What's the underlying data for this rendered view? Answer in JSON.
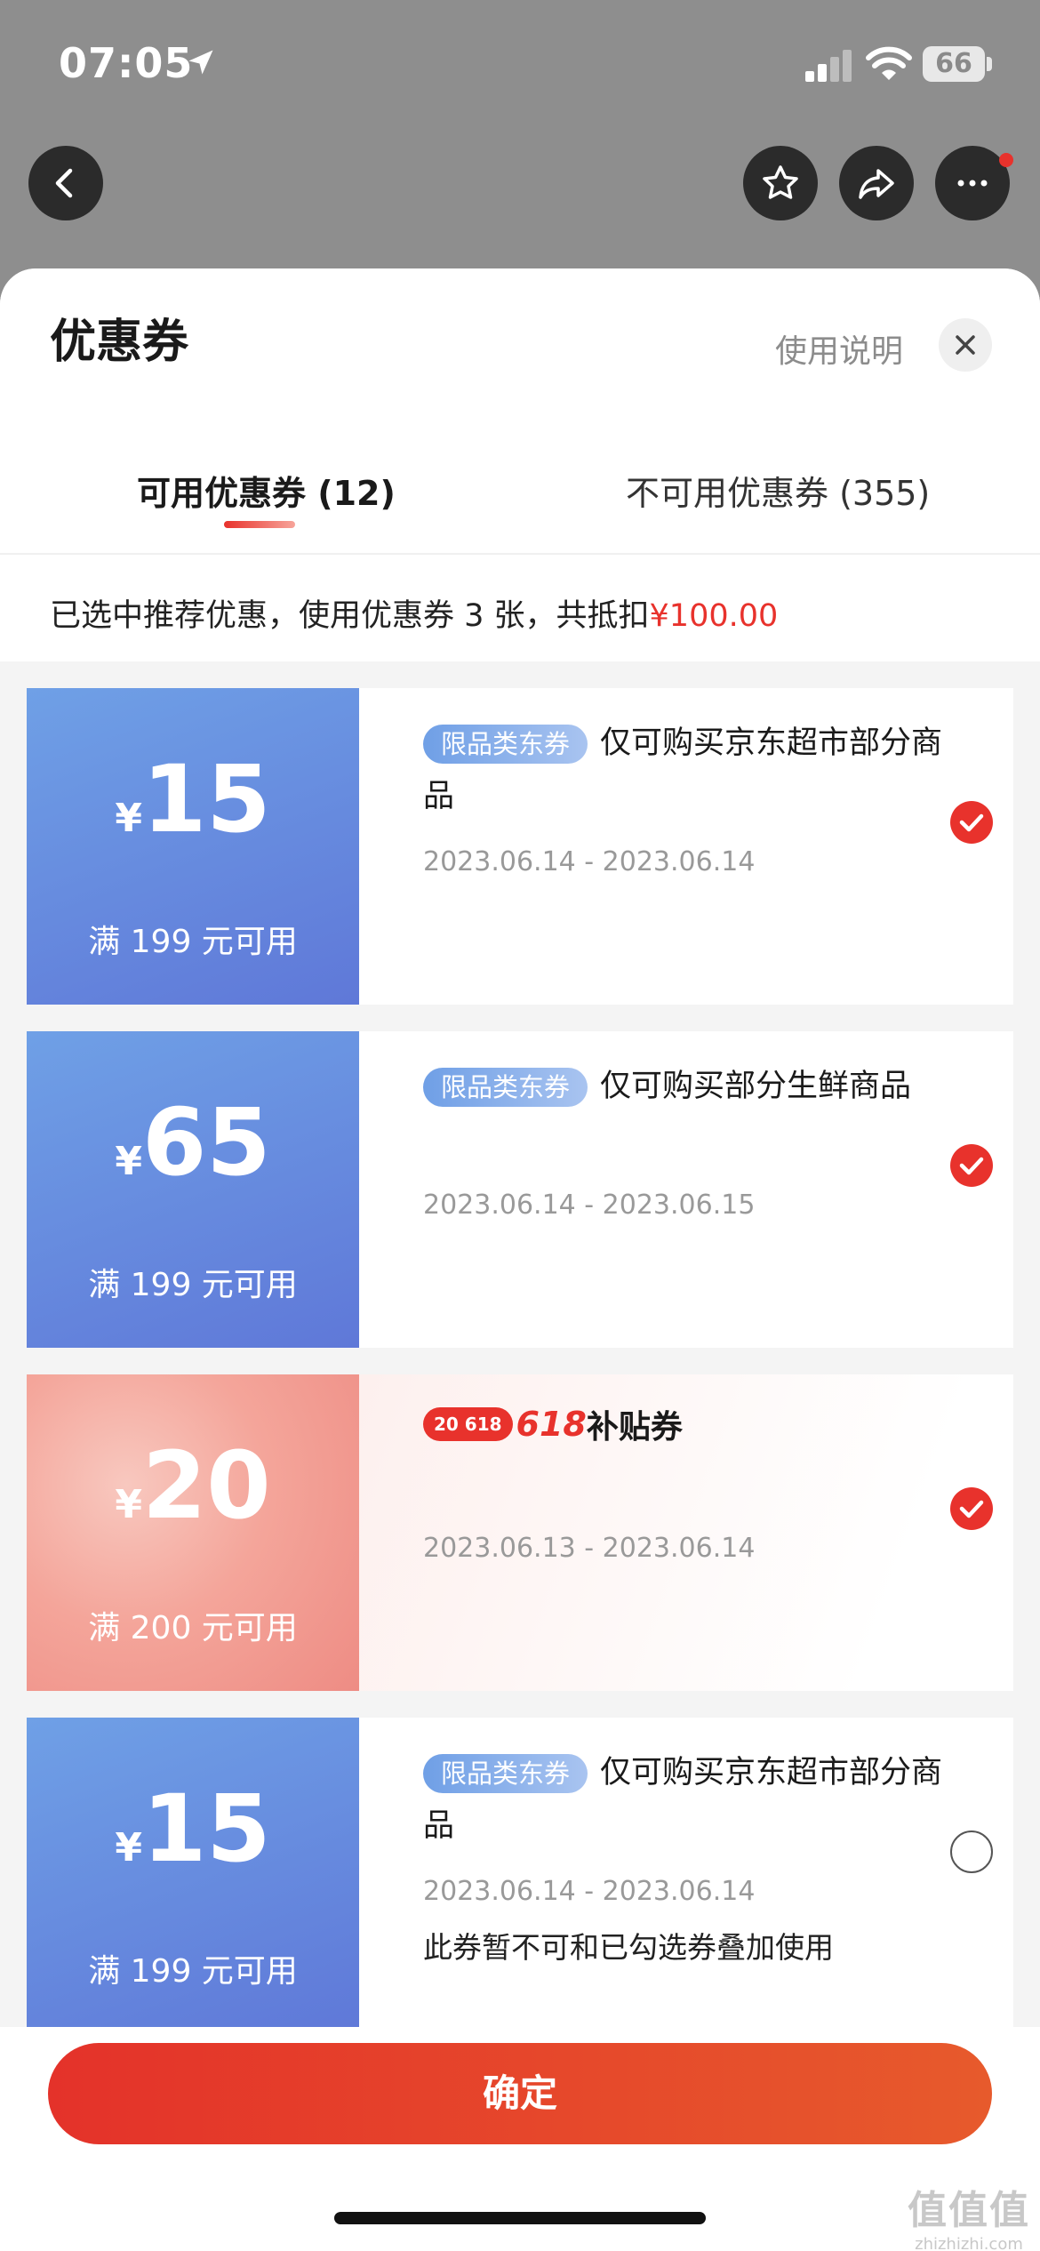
{
  "status_bar": {
    "time": "07:05",
    "battery": "66"
  },
  "sheet": {
    "title": "优惠券",
    "help_link": "使用说明",
    "tabs": [
      {
        "label": "可用优惠券 (12)",
        "active": true
      },
      {
        "label": "不可用优惠券 (355)",
        "active": false
      }
    ],
    "summary": {
      "text": "已选中推荐优惠，使用优惠券 3 张，共抵扣",
      "amount": "¥100.00"
    }
  },
  "coupons": [
    {
      "currency": "¥",
      "amount": "15",
      "condition": "满 199 元可用",
      "badge": "限品类东券",
      "description": "仅可购买京东超市部分商品",
      "date": "2023.06.14 - 2023.06.14",
      "checked": true
    },
    {
      "currency": "¥",
      "amount": "65",
      "condition": "满 199 元可用",
      "badge": "限品类东券",
      "description": "仅可购买部分生鲜商品",
      "date": "2023.06.14 - 2023.06.15",
      "checked": true
    },
    {
      "currency": "¥",
      "amount": "20",
      "condition": "满 200 元可用",
      "tag_pill": "20 618",
      "tag_number": "618",
      "tag_text": "补贴券",
      "date": "2023.06.13 - 2023.06.14",
      "checked": true
    },
    {
      "currency": "¥",
      "amount": "15",
      "condition": "满 199 元可用",
      "badge": "限品类东券",
      "description": "仅可购买京东超市部分商品",
      "date": "2023.06.14 - 2023.06.14",
      "note": "此券暂不可和已勾选券叠加使用",
      "checked": false
    }
  ],
  "confirm_label": "确定",
  "watermark": {
    "big": "值值值",
    "small": "zhizhizhi.com"
  },
  "colors": {
    "accent_red": "#e8322c",
    "coupon_blue": "#6a8ee0",
    "coupon_pink": "#f4a59a"
  }
}
